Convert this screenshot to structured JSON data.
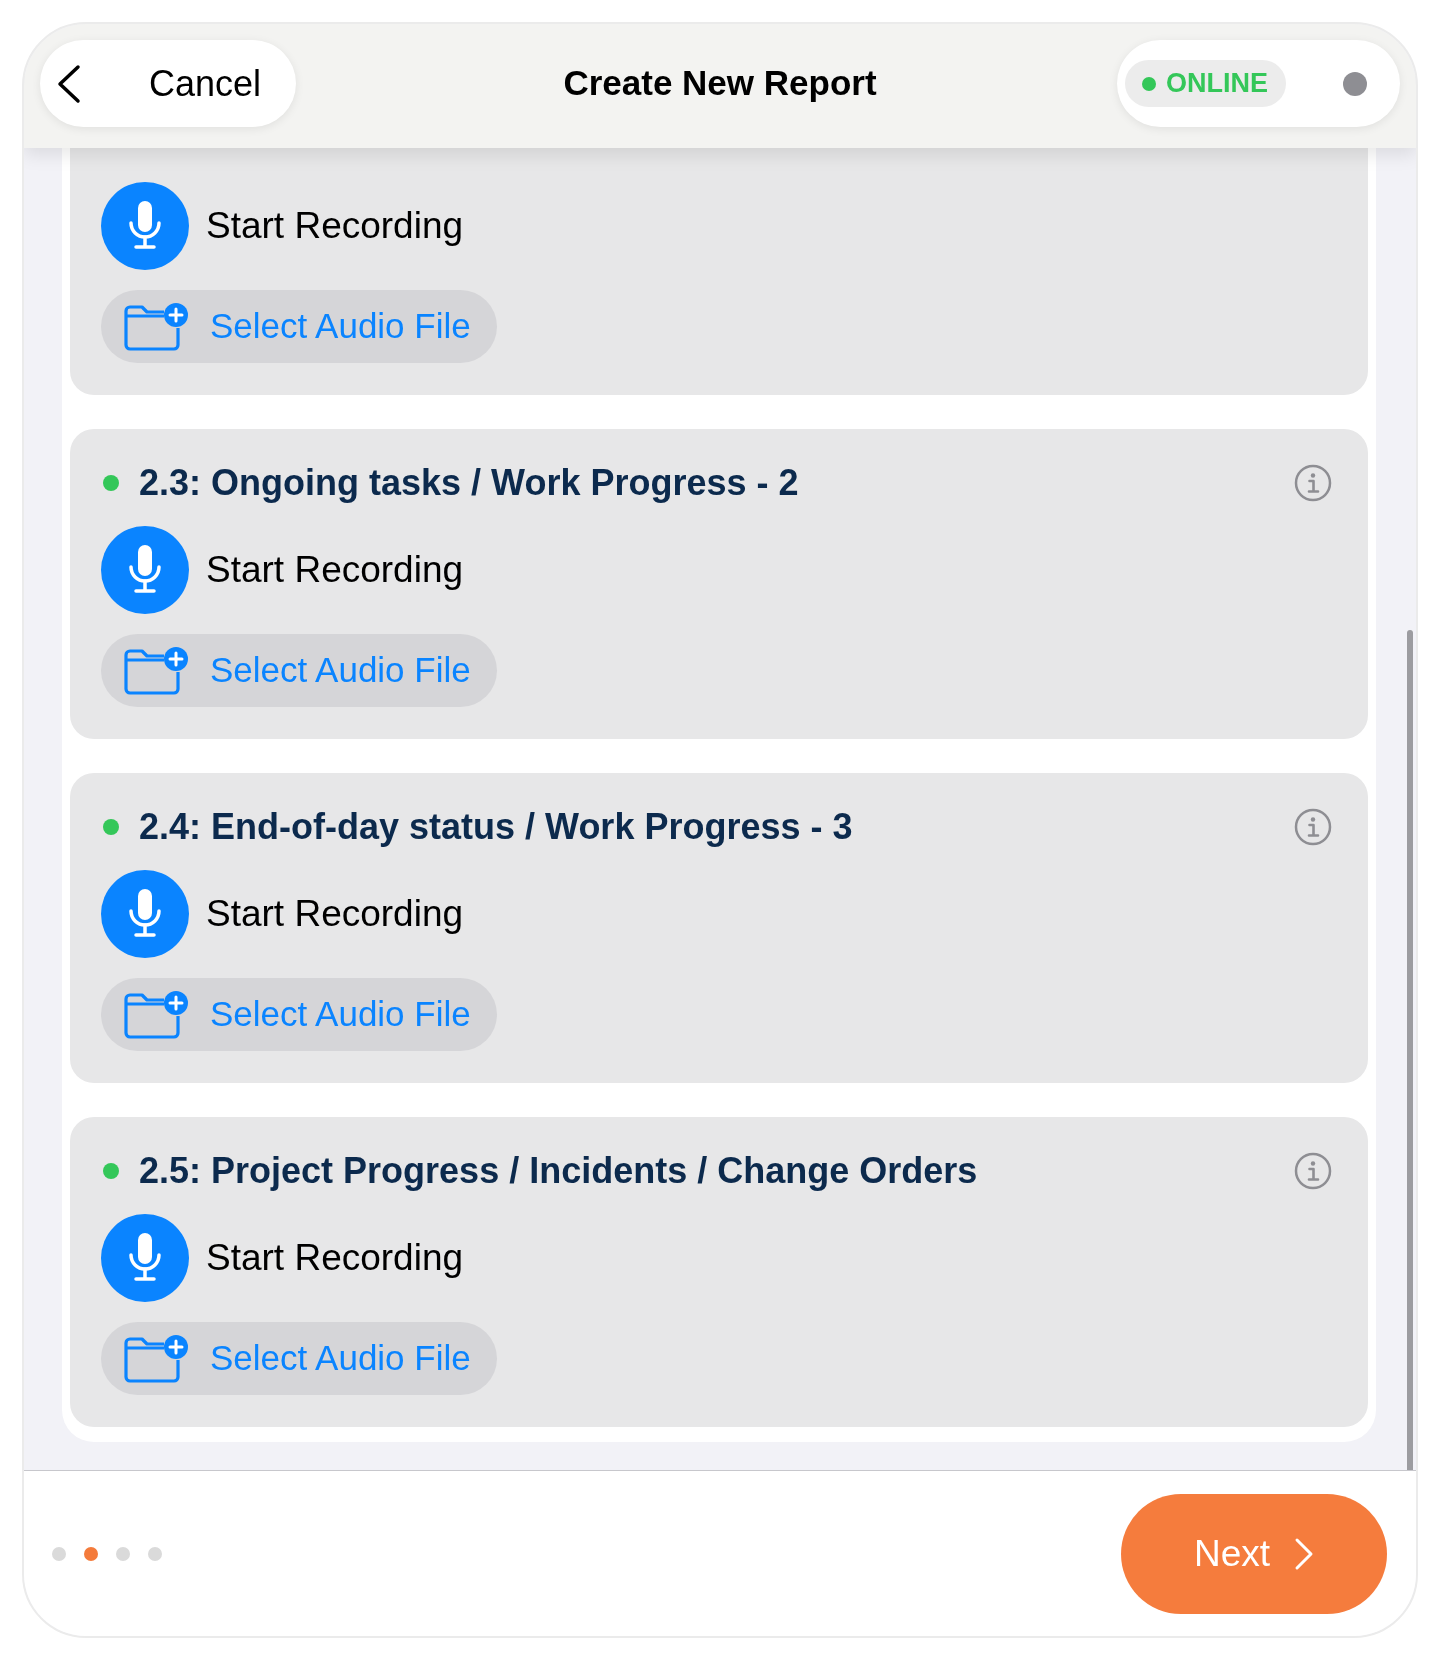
{
  "header": {
    "cancel_label": "Cancel",
    "title": "Create New Report",
    "status": {
      "label": "ONLINE",
      "online": true
    }
  },
  "sections": [
    {
      "record_label": "Start Recording",
      "file_label": "Select Audio File"
    },
    {
      "title": "2.3: Ongoing tasks / Work Progress - 2",
      "color": "#34c759",
      "record_label": "Start Recording",
      "file_label": "Select Audio File"
    },
    {
      "title": "2.4: End-of-day status / Work Progress - 3",
      "color": "#34c759",
      "record_label": "Start Recording",
      "file_label": "Select Audio File"
    },
    {
      "title": "2.5: Project Progress / Incidents / Change Orders",
      "color": "#34c759",
      "record_label": "Start Recording",
      "file_label": "Select Audio File"
    }
  ],
  "pager": [
    {
      "selected": false
    },
    {
      "selected": true
    },
    {
      "selected": false
    },
    {
      "selected": false
    }
  ],
  "next_label": "Next"
}
